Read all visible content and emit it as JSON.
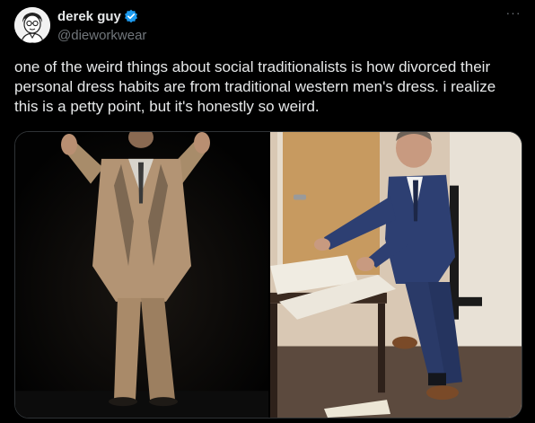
{
  "author": {
    "display_name": "derek guy",
    "handle": "@dieworkwear",
    "avatar_icon": "cartoon-portrait-avatar",
    "verified_icon": "verified-badge-icon",
    "verified_color": "#1d9bf0"
  },
  "menu": {
    "more_label": "···"
  },
  "tweet": {
    "text": "one of the weird things about social traditionalists is how divorced their\npersonal dress habits are from traditional western men's dress. i realize\nthis is a petty point, but it's honestly so weird."
  },
  "media": {
    "photos": [
      {
        "icon": "man-in-tan-three-piece-suit-on-stage-photo"
      },
      {
        "icon": "man-in-blue-suit-signing-books-photo"
      }
    ]
  },
  "colors": {
    "background": "#000000",
    "text": "#e7e9ea",
    "secondary": "#71767b",
    "border": "#2f3336"
  }
}
